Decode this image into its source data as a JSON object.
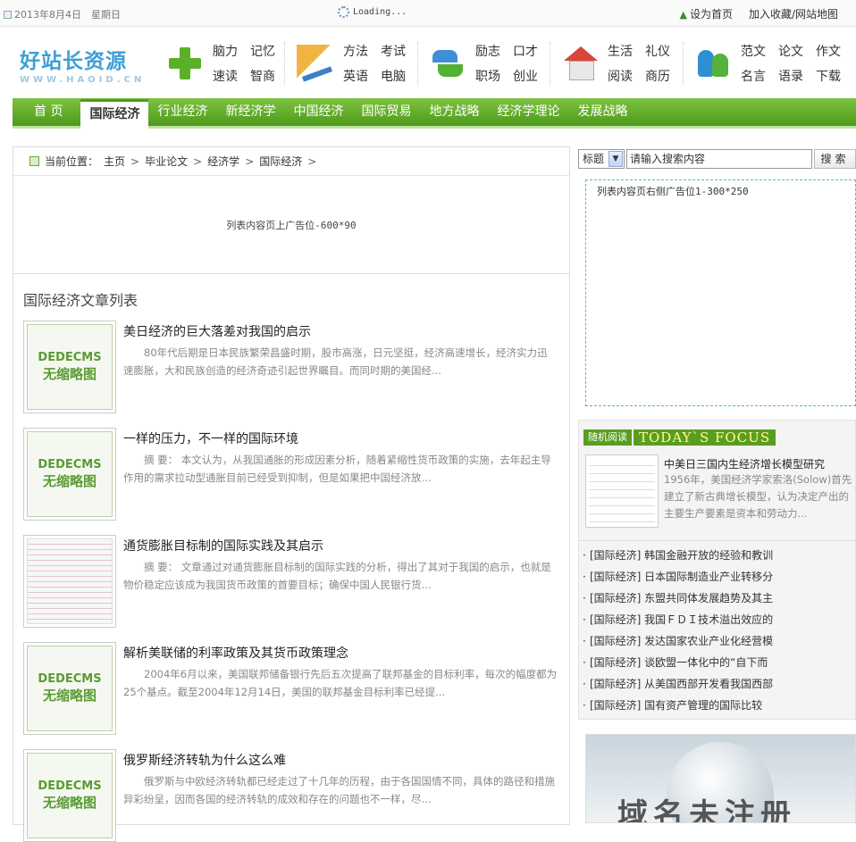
{
  "topbar": {
    "date": "2013年8月4日　星期日",
    "loading": "Loading...",
    "set_home": "设为首页",
    "favorites": "加入收藏/网站地图"
  },
  "logo": {
    "main": "好站长资源",
    "sub": "WWW.HAOID.CN"
  },
  "header_groups": [
    {
      "icon": "plus-icon",
      "words": [
        "脑力",
        "记忆",
        "速读",
        "智商"
      ]
    },
    {
      "icon": "ruler-icon",
      "words": [
        "方法",
        "考试",
        "英语",
        "电脑"
      ]
    },
    {
      "icon": "arrow-icon",
      "words": [
        "励志",
        "口才",
        "职场",
        "创业"
      ]
    },
    {
      "icon": "house-icon",
      "words": [
        "生活",
        "礼仪",
        "阅读",
        "商历"
      ]
    },
    {
      "icon": "people-icon",
      "words": [
        "范文",
        "论文",
        "作文",
        "名言",
        "语录",
        "下载"
      ]
    }
  ],
  "main_nav": [
    "首 页",
    "国际经济",
    "行业经济",
    "新经济学",
    "中国经济",
    "国际贸易",
    "地方战略",
    "经济学理论",
    "发展战略"
  ],
  "breadcrumb": {
    "prefix": "当前位置：",
    "items": [
      "主页",
      "毕业论文",
      "经济学",
      "国际经济"
    ]
  },
  "ad_top": "列表内容页上广告位-600*90",
  "list_title": "国际经济文章列表",
  "thumb_placeholder": {
    "line1": "DEDECMS",
    "line2": "无缩略图"
  },
  "articles": [
    {
      "title": "美日经济的巨大落差对我国的启示",
      "desc": "80年代后期是日本民族繁荣昌盛时期，股市高涨，日元坚挺，经济高速增长，经济实力迅速膨胀，大和民族创造的经济奇迹引起世界瞩目。而同时期的美国经..."
    },
    {
      "title": "一样的压力，不一样的国际环境",
      "desc": "摘 要： 本文认为，从我国通胀的形成因素分析，随着紧缩性货币政策的实施，去年起主导作用的需求拉动型通胀目前已经受到抑制，但是如果把中国经济放..."
    },
    {
      "title": "通货膨胀目标制的国际实践及其启示",
      "desc": "摘 要： 文章通过对通货膨胀目标制的国际实践的分析，得出了其对于我国的启示，也就是物价稳定应该成为我国货币政策的首要目标；确保中国人民银行货..."
    },
    {
      "title": "解析美联储的利率政策及其货币政策理念",
      "desc": "2004年6月以来，美国联邦储备银行先后五次提高了联邦基金的目标利率，每次的幅度都为25个基点。截至2004年12月14日，美国的联邦基金目标利率已经提..."
    },
    {
      "title": "俄罗斯经济转轨为什么这么难",
      "desc": "俄罗斯与中欧经济转轨都已经走过了十几年的历程，由于各国国情不同，具体的路径和措施异彩纷呈，因而各国的经济转轨的成效和存在的问题也不一样，尽..."
    }
  ],
  "search": {
    "select": "标题",
    "input": "请输入搜索内容",
    "button": "搜索"
  },
  "ad_right": "列表内容页右侧广告位1-300*250",
  "focus": {
    "tag": "随机阅读",
    "en": "TODAY`S FOCUS",
    "title": "中美日三国内生经济增长模型研究",
    "desc": "1956年，美国经济学家索洛(Solow)首先建立了新古典增长模型，认为决定产出的主要生产要素是资本和劳动力...",
    "list": [
      "[国际经济] 韩国金融开放的经验和教训",
      "[国际经济] 日本国际制造业产业转移分",
      "[国际经济] 东盟共同体发展趋势及其主",
      "[国际经济] 我国ＦＤＩ技术溢出效应的",
      "[国际经济] 发达国家农业产业化经营模",
      "[国际经济] 谈欧盟一体化中的“自下而",
      "[国际经济] 从美国西部开发看我国西部",
      "[国际经济] 国有资产管理的国际比较"
    ]
  },
  "bottom_banner": "域名未注册"
}
